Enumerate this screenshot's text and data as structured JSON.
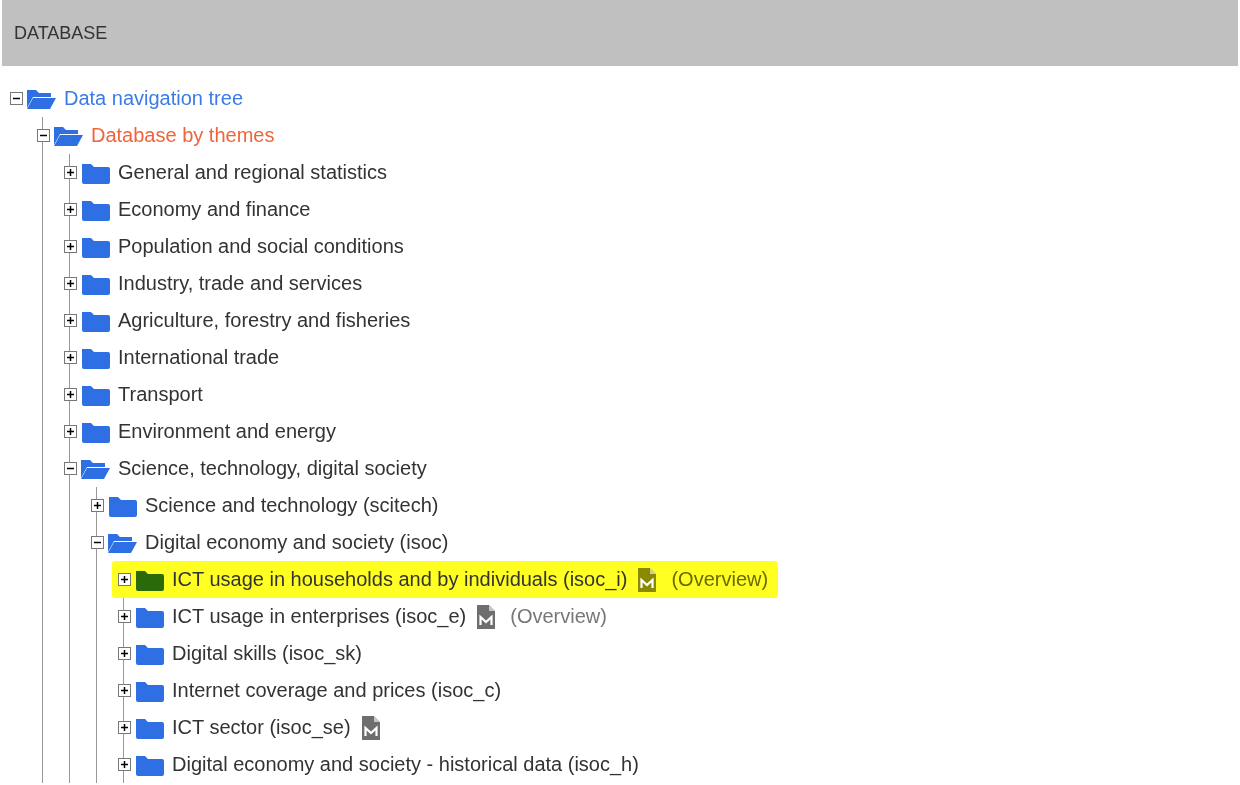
{
  "header": {
    "title": "DATABASE"
  },
  "tree": [
    {
      "label": "Data navigation tree",
      "color": "#3b7be8",
      "expanded": true,
      "selected": false,
      "children": [
        {
          "label": "Database by themes",
          "color": "#f0643c",
          "expanded": true,
          "selected": false,
          "children": [
            {
              "label": "General and regional statistics",
              "expanded": false,
              "selected": false
            },
            {
              "label": "Economy and finance",
              "expanded": false,
              "selected": false
            },
            {
              "label": "Population and social conditions",
              "expanded": false,
              "selected": false
            },
            {
              "label": "Industry, trade and services",
              "expanded": false,
              "selected": false
            },
            {
              "label": "Agriculture, forestry and fisheries",
              "expanded": false,
              "selected": false
            },
            {
              "label": "International trade",
              "expanded": false,
              "selected": false
            },
            {
              "label": "Transport",
              "expanded": false,
              "selected": false
            },
            {
              "label": "Environment and energy",
              "expanded": false,
              "selected": false
            },
            {
              "label": "Science, technology, digital society",
              "expanded": true,
              "selected": false,
              "children": [
                {
                  "label": "Science and technology (scitech)",
                  "expanded": false,
                  "selected": false
                },
                {
                  "label": "Digital economy and society (isoc)",
                  "expanded": true,
                  "selected": false,
                  "children": [
                    {
                      "label": "ICT usage in households and by individuals (isoc_i)",
                      "expanded": false,
                      "selected": true,
                      "metadata": true,
                      "overview": "(Overview)"
                    },
                    {
                      "label": "ICT usage in enterprises (isoc_e)",
                      "expanded": false,
                      "selected": false,
                      "metadata": true,
                      "overview": "(Overview)"
                    },
                    {
                      "label": "Digital skills (isoc_sk)",
                      "expanded": false,
                      "selected": false
                    },
                    {
                      "label": "Internet coverage and prices (isoc_c)",
                      "expanded": false,
                      "selected": false
                    },
                    {
                      "label": "ICT sector (isoc_se)",
                      "expanded": false,
                      "selected": false,
                      "metadata": true
                    },
                    {
                      "label": "Digital economy and society - historical data (isoc_h)",
                      "expanded": false,
                      "selected": false
                    }
                  ]
                }
              ]
            }
          ]
        }
      ]
    }
  ]
}
